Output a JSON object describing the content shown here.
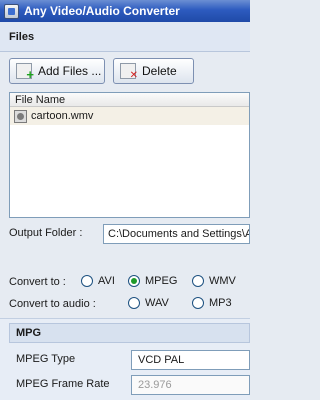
{
  "window": {
    "title": "Any Video/Audio Converter",
    "icon": "app-icon"
  },
  "files": {
    "section_label": "Files",
    "add_button": "Add Files ...",
    "delete_button": "Delete",
    "list_header": "File Name",
    "items": [
      {
        "name": "cartoon.wmv",
        "icon": "video-file-icon"
      }
    ]
  },
  "output": {
    "label": "Output Folder :",
    "value": "C:\\Documents and Settings\\A"
  },
  "convert_to": {
    "label": "Convert to :",
    "options": [
      "AVI",
      "MPEG",
      "WMV"
    ],
    "selected": "MPEG"
  },
  "convert_audio": {
    "label": "Convert to audio :",
    "options": [
      "WAV",
      "MP3"
    ],
    "selected": null
  },
  "mpg": {
    "section_label": "MPG",
    "type_label": "MPEG Type",
    "type_value": "VCD PAL",
    "frame_rate_label": "MPEG Frame Rate",
    "frame_rate_value": "23.976"
  }
}
